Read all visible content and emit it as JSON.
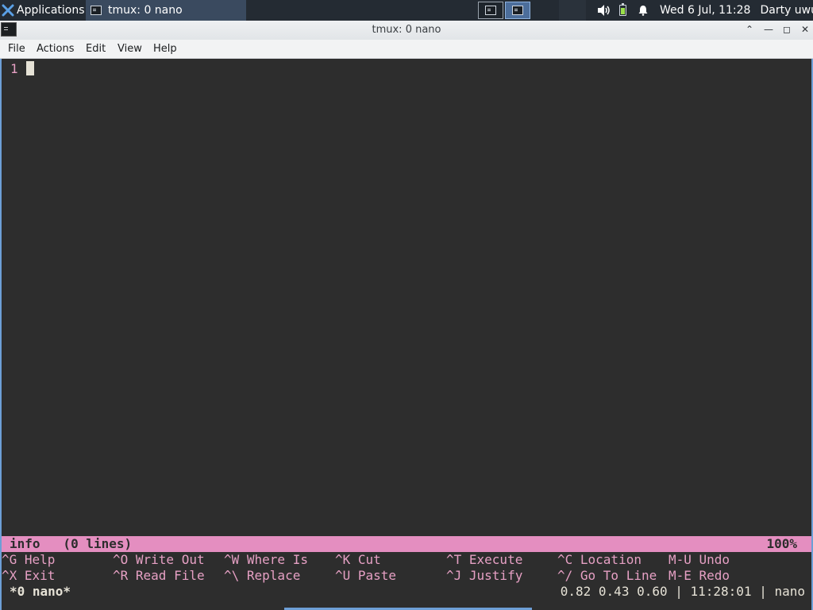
{
  "panel": {
    "applications_label": "Applications",
    "applications_sep": "☰",
    "task_title": "tmux: 0 nano",
    "clock": "Wed  6 Jul, 11:28",
    "user": "Darty uwu"
  },
  "window": {
    "title": "tmux: 0 nano",
    "btn_up": "⌃",
    "btn_min": "—",
    "btn_max": "◻",
    "btn_close": "✕"
  },
  "menu": {
    "items": [
      "File",
      "Actions",
      "Edit",
      "View",
      "Help"
    ]
  },
  "editor": {
    "line_number": "1",
    "status_left": "info   (0 lines)",
    "status_right": "100%"
  },
  "shortcuts": {
    "row1": [
      "^G Help",
      "^O Write Out",
      "^W Where Is",
      "^K Cut",
      "^T Execute",
      "^C Location",
      "M-U Undo"
    ],
    "row2": [
      "^X Exit",
      "^R Read File",
      "^\\ Replace",
      "^U Paste",
      "^J Justify",
      "^/ Go To Line",
      "M-E Redo"
    ]
  },
  "tmux": {
    "window_label": "*0 nano*",
    "right_status": "0.82 0.43 0.60 | 11:28:01 | nano"
  }
}
